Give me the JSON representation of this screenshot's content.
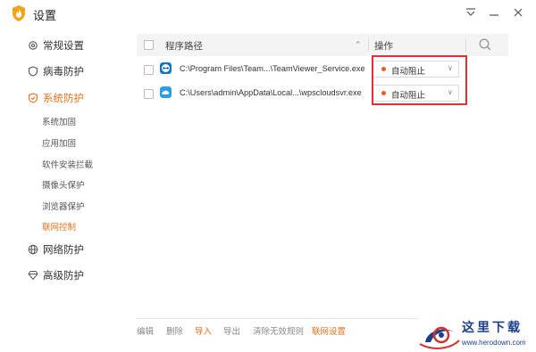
{
  "window": {
    "title": "设置",
    "icons": {
      "logo": "shield-flame-logo",
      "menu": "menu-icon",
      "minimize": "minimize-icon",
      "close": "close-icon"
    }
  },
  "sidebar": {
    "items": [
      {
        "label": "常规设置",
        "icon": "gear-icon"
      },
      {
        "label": "病毒防护",
        "icon": "shield-icon"
      },
      {
        "label": "系统防护",
        "icon": "shield-check-icon",
        "active": true
      },
      {
        "label": "网络防护",
        "icon": "globe-icon"
      },
      {
        "label": "高级防护",
        "icon": "diamond-icon"
      }
    ],
    "sub_items": [
      {
        "label": "系统加固"
      },
      {
        "label": "应用加固"
      },
      {
        "label": "软件安装拦截"
      },
      {
        "label": "摄像头保护"
      },
      {
        "label": "浏览器保护"
      },
      {
        "label": "联网控制",
        "active": true
      }
    ]
  },
  "table": {
    "header": {
      "path": "程序路径",
      "operation": "操作"
    },
    "rows": [
      {
        "path": "C:\\Program Files\\Team...\\TeamViewer_Service.exe",
        "app_icon": "teamviewer-icon",
        "action": "自动阻止",
        "checked": false
      },
      {
        "path": "C:\\Users\\admin\\AppData\\Local...\\wpscloudsvr.exe",
        "app_icon": "wps-cloud-icon",
        "action": "自动阻止",
        "checked": false
      }
    ]
  },
  "footer": {
    "buttons": [
      {
        "label": "编辑",
        "highlight": false
      },
      {
        "label": "删除",
        "highlight": false
      },
      {
        "label": "导入",
        "highlight": true
      },
      {
        "label": "导出",
        "highlight": false
      },
      {
        "label": "清除无效规则",
        "highlight": false
      },
      {
        "label": "联网设置",
        "highlight": true
      }
    ]
  },
  "watermark": {
    "title": "这里下载",
    "url": "www.herodown.com"
  },
  "colors": {
    "accent": "#e8721e",
    "highlight_border": "#e0303b",
    "status_dot": "#ef5c24"
  }
}
